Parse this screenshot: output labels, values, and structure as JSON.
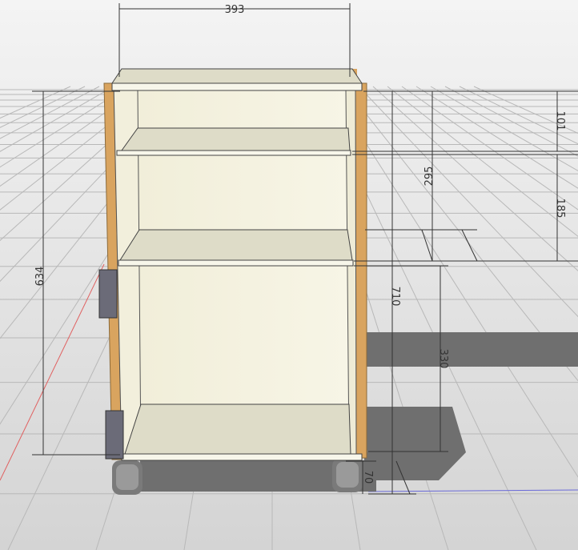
{
  "viewport": {
    "background_top": "#f2f2f2",
    "background_bottom": "#d6d6d6",
    "grid_color": "#b9b9b9",
    "shadow_color": "#6f6f6f",
    "wood_color": "#d9a45f",
    "panel_color": "#f4f1df",
    "shelf_color": "#dedcc8",
    "hinge_color": "#6b6b78",
    "wheel_color": "#7a7a7a",
    "dim_color": "#333333"
  },
  "dimensions": {
    "width_top": "393",
    "height_left": "634",
    "height_right_total": "710",
    "upper_gap": "101",
    "upper_section": "295",
    "middle_gap": "185",
    "lower_section": "330",
    "base_height": "70"
  }
}
